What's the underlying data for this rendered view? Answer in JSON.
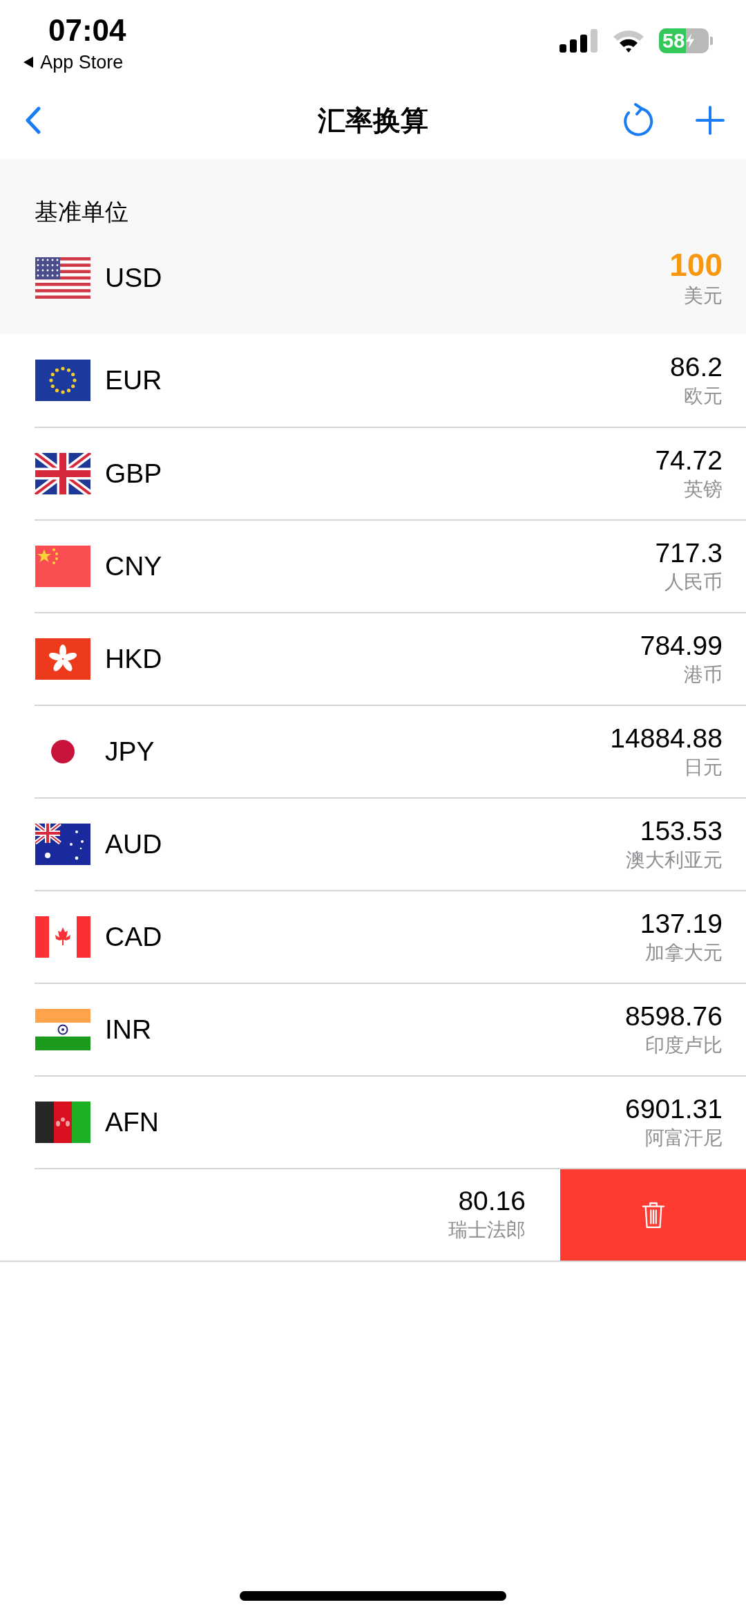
{
  "status_bar": {
    "time": "07:04",
    "back_label": "App Store",
    "battery": "58"
  },
  "nav": {
    "title": "汇率换算"
  },
  "base": {
    "header": "基准单位",
    "code": "USD",
    "value": "100",
    "name": "美元"
  },
  "rows": [
    {
      "code": "EUR",
      "value": "86.2",
      "name": "欧元"
    },
    {
      "code": "GBP",
      "value": "74.72",
      "name": "英镑"
    },
    {
      "code": "CNY",
      "value": "717.3",
      "name": "人民币"
    },
    {
      "code": "HKD",
      "value": "784.99",
      "name": "港币"
    },
    {
      "code": "JPY",
      "value": "14884.88",
      "name": "日元"
    },
    {
      "code": "AUD",
      "value": "153.53",
      "name": "澳大利亚元"
    },
    {
      "code": "CAD",
      "value": "137.19",
      "name": "加拿大元"
    },
    {
      "code": "INR",
      "value": "8598.76",
      "name": "印度卢比"
    },
    {
      "code": "AFN",
      "value": "6901.31",
      "name": "阿富汗尼"
    }
  ],
  "swiped_row": {
    "value": "80.16",
    "name": "瑞士法郎"
  }
}
